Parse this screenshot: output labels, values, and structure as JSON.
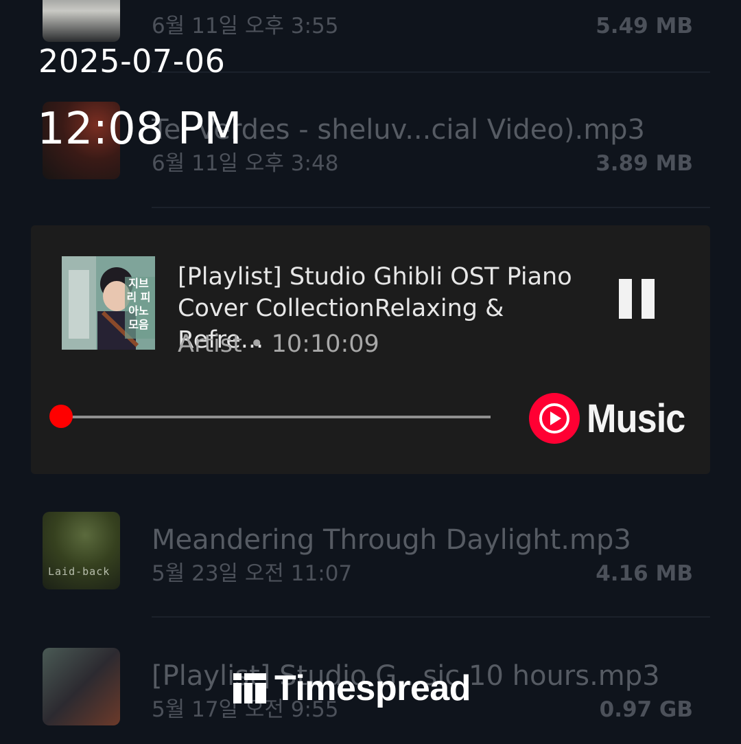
{
  "overlay": {
    "date": "2025-07-06",
    "time": "12:08 PM"
  },
  "files": [
    {
      "name": "",
      "date": "6월 11일 오후 3:55",
      "size": "5.49 MB"
    },
    {
      "name": "Tei Verdes - sheluv...cial Video).mp3",
      "date": "6월 11일 오후 3:48",
      "size": "3.89 MB"
    },
    {
      "name": "Meandering Through Daylight.mp3",
      "date": "5월 23일 오전 11:07",
      "size": "4.16 MB",
      "thumb_text": "Laid-back"
    },
    {
      "name": "[Playlist] Studio G...sic 10 hours.mp3",
      "date": "5월 17일 오전 9:55",
      "size": "0.97 GB"
    }
  ],
  "player": {
    "title": "[Playlist] Studio Ghibli OST Piano Cover CollectionRelaxing & Refre...",
    "title_line1": "[Playlist] Studio Ghibli OST Piano",
    "title_line2": "Cover CollectionRelaxing & Refre...",
    "subtitle": "Artist • 10:10:09",
    "progress": 0.0,
    "pause_icon": "pause-icon",
    "brand": "Music",
    "brand_icon": "youtube-music-icon",
    "accent_color": "#ff0000",
    "album_art_text": "지브리 피아노 모음"
  },
  "watermark": {
    "text": "Timespread",
    "icon": "timespread-logo-icon"
  }
}
